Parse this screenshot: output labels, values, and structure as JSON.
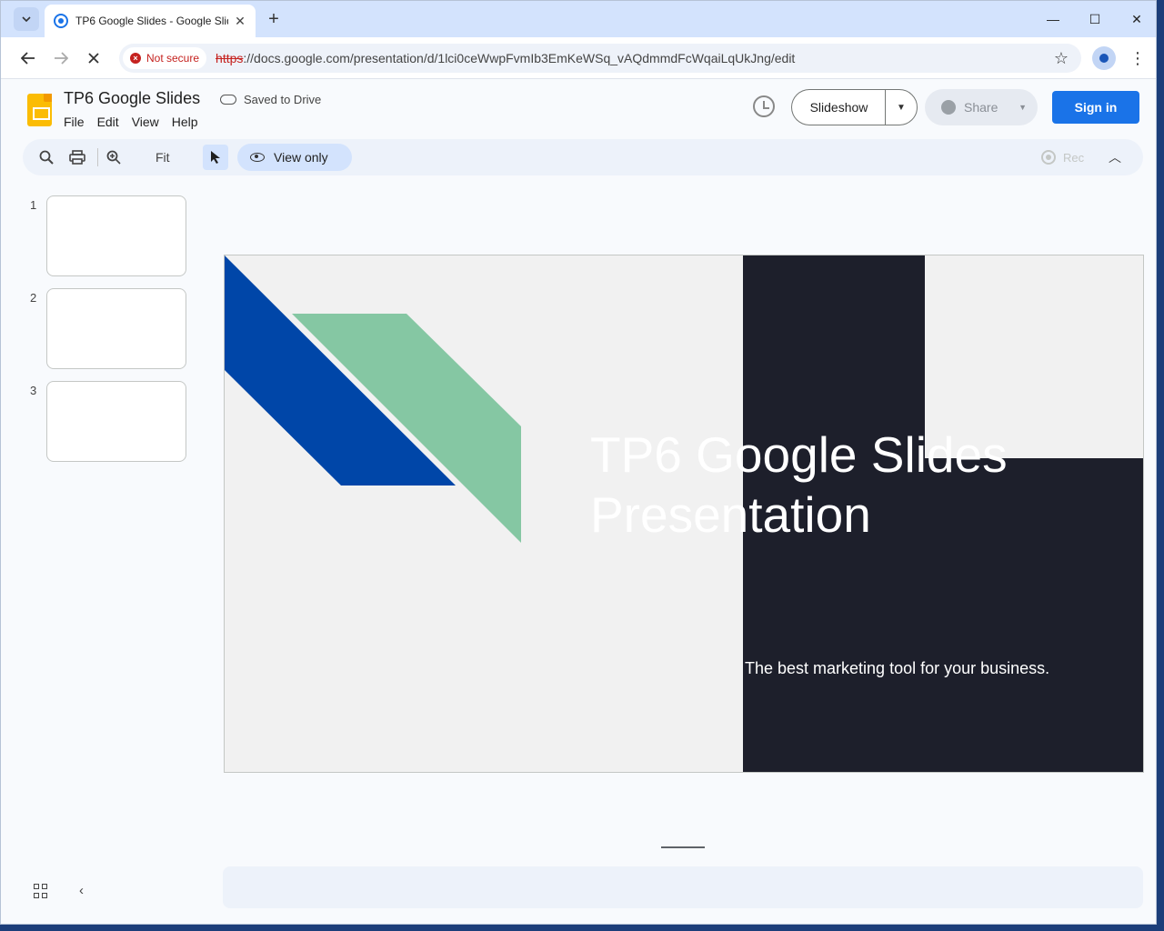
{
  "browser": {
    "tab_title": "TP6 Google Slides - Google Slides",
    "tab_close": "✕",
    "new_tab": "+",
    "minimize": "—",
    "maximize": "☐",
    "close": "✕",
    "security_label": "Not secure",
    "url_scheme": "https",
    "url_rest": "://docs.google.com/presentation/d/1lci0ceWwpFvmIb3EmKeWSq_vAQdmmdFcWqaiLqUkJng/edit"
  },
  "app": {
    "doc_title": "TP6 Google Slides",
    "save_status": "Saved to Drive",
    "menu": [
      "File",
      "Edit",
      "View",
      "Help"
    ],
    "slideshow_label": "Slideshow",
    "share_label": "Share",
    "signin_label": "Sign in"
  },
  "toolbar": {
    "zoom_label": "Fit",
    "view_mode_label": "View only",
    "rec_label": "Rec"
  },
  "filmstrip": {
    "slide_numbers": [
      "1",
      "2",
      "3"
    ]
  },
  "slide": {
    "title_line1": "TP6 Google Slides",
    "title_line2": "Presentation",
    "subtitle": "The best marketing tool for your business.",
    "colors": {
      "background": "#f1f1f1",
      "dark_panel": "#1d1f2b",
      "blue_shape": "#0046a8",
      "green_shape": "#85c7a3"
    }
  },
  "icons": {
    "back": "back-arrow-icon",
    "forward": "forward-arrow-icon",
    "stop": "stop-loading-icon",
    "star": "bookmark-star-icon",
    "search": "search-icon",
    "print": "print-icon",
    "zoom": "zoom-in-icon",
    "history": "history-icon"
  }
}
